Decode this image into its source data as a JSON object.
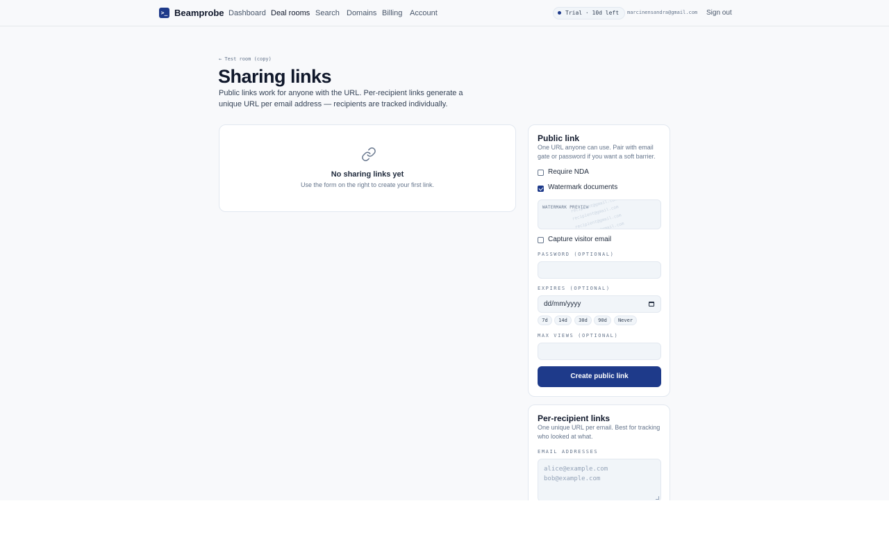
{
  "header": {
    "logo_glyph": ">_",
    "brand": "Beamprobe",
    "nav": [
      {
        "label": "Dashboard",
        "active": false
      },
      {
        "label": "Deal rooms",
        "active": true
      },
      {
        "label": "Search",
        "active": false
      },
      {
        "label": "Domains",
        "active": false
      },
      {
        "label": "Billing",
        "active": false
      },
      {
        "label": "Account",
        "active": false
      }
    ],
    "trial_badge": "Trial · 10d left",
    "user_email": "marcinensandra@gmail.com",
    "sign_out": "Sign out"
  },
  "page": {
    "back_link": "← Test room (copy)",
    "title": "Sharing links",
    "subtitle": "Public links work for anyone with the URL. Per-recipient links generate a unique URL per email address — recipients are tracked individually."
  },
  "empty_state": {
    "icon": "link-icon",
    "title": "No sharing links yet",
    "description": "Use the form on the right to create your first link."
  },
  "public_link": {
    "title": "Public link",
    "description": "One URL anyone can use. Pair with email gate or password if you want a soft barrier.",
    "require_nda": {
      "label": "Require NDA",
      "checked": false
    },
    "watermark": {
      "label": "Watermark documents",
      "checked": true
    },
    "watermark_preview": {
      "label": "WATERMARK PREVIEW",
      "sample_texts": [
        "recipient@gmail.com",
        "recipient@gmail.com",
        "recipient@gmail.com",
        "recipient@gmail.com"
      ]
    },
    "capture_email": {
      "label": "Capture visitor email",
      "checked": false
    },
    "password": {
      "label": "PASSWORD (OPTIONAL)",
      "value": ""
    },
    "expires": {
      "label": "EXPIRES (OPTIONAL)",
      "placeholder": "dd/mm/yyyy"
    },
    "expiry_presets": [
      "7d",
      "14d",
      "30d",
      "90d",
      "Never"
    ],
    "max_views": {
      "label": "MAX VIEWS (OPTIONAL)",
      "value": ""
    },
    "submit": "Create public link"
  },
  "per_recipient": {
    "title": "Per-recipient links",
    "description": "One unique URL per email. Best for tracking who looked at what.",
    "emails_label": "EMAIL ADDRESSES",
    "emails_placeholder": [
      "alice@example.com",
      "bob@example.com"
    ]
  },
  "colors": {
    "brand": "#1e3a8a",
    "background": "#f8f9fb",
    "card": "#ffffff",
    "border": "#e2e8f0"
  }
}
